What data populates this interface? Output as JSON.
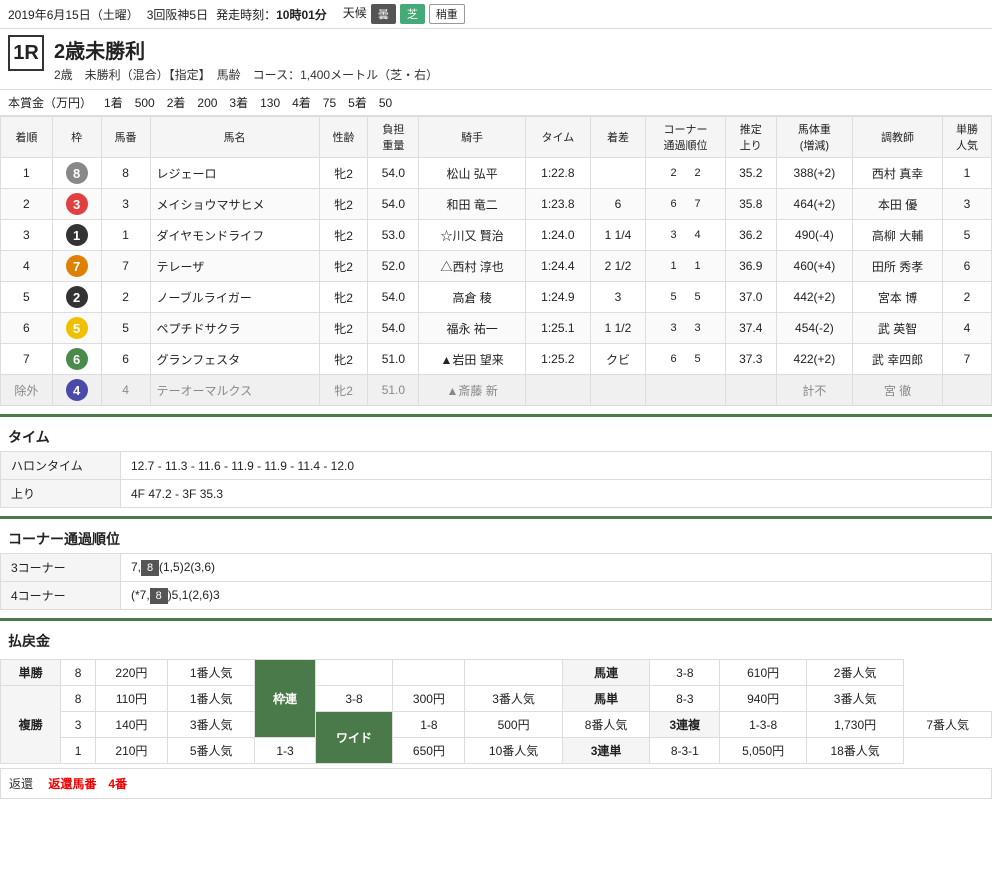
{
  "header": {
    "date": "2019年6月15日（土曜）",
    "session": "3回阪神5日",
    "start_time_label": "発走時刻：",
    "start_time": "10時01分",
    "weather_label": "天候",
    "weather": "曇",
    "track_label": "芝",
    "track_condition": "稍重"
  },
  "race": {
    "number": "1R",
    "title": "2歳未勝利",
    "subtitle1": "2歳　未勝利（混合）【指定】　馬齢　コース：1,400メートル（芝・右）"
  },
  "prize": {
    "label": "本賞金（万円）",
    "items": [
      {
        "place": "1着",
        "amount": "500"
      },
      {
        "place": "2着",
        "amount": "200"
      },
      {
        "place": "3着",
        "amount": "130"
      },
      {
        "place": "4着",
        "amount": "75"
      },
      {
        "place": "5着",
        "amount": "50"
      }
    ]
  },
  "table_headers": {
    "rank": "着順",
    "frame": "枠",
    "horse_num": "馬番",
    "horse_name": "馬名",
    "sex_age": "性齢",
    "weight": "負担\n重量",
    "jockey": "騎手",
    "time": "タイム",
    "margin": "着差",
    "corner": "コーナー\n通過順位",
    "last3f": "推定\n上り",
    "horse_weight": "馬体重\n(増減)",
    "trainer": "調教師",
    "odds": "単勝\n人気"
  },
  "results": [
    {
      "rank": "1",
      "frame": "8",
      "frame_color": "#888",
      "horse_num": "8",
      "horse_name": "レジェーロ",
      "sex_age": "牝2",
      "weight": "54.0",
      "jockey": "松山 弘平",
      "time": "1:22.8",
      "margin": "",
      "corner1": "2",
      "corner2": "2",
      "c1_hl": false,
      "c2_hl": false,
      "last3f": "35.2",
      "horse_weight": "388(+2)",
      "trainer": "西村 真幸",
      "odds": "1",
      "excluded": false
    },
    {
      "rank": "2",
      "frame": "3",
      "frame_color": "#e04040",
      "horse_num": "3",
      "horse_name": "メイショウマサヒメ",
      "sex_age": "牝2",
      "weight": "54.0",
      "jockey": "和田 竜二",
      "time": "1:23.8",
      "margin": "6",
      "corner1": "6",
      "corner2": "7",
      "c1_hl": false,
      "c2_hl": false,
      "last3f": "35.8",
      "horse_weight": "464(+2)",
      "trainer": "本田 優",
      "odds": "3",
      "excluded": false
    },
    {
      "rank": "3",
      "frame": "1",
      "frame_color": "#333",
      "horse_num": "1",
      "horse_name": "ダイヤモンドライフ",
      "sex_age": "牝2",
      "weight": "53.0",
      "jockey": "☆川又 賢治",
      "time": "1:24.0",
      "margin": "1 1/4",
      "corner1": "3",
      "corner2": "4",
      "c1_hl": false,
      "c2_hl": false,
      "last3f": "36.2",
      "horse_weight": "490(-4)",
      "trainer": "高柳 大輔",
      "odds": "5",
      "excluded": false
    },
    {
      "rank": "4",
      "frame": "7",
      "frame_color": "#e08000",
      "horse_num": "7",
      "horse_name": "テレーザ",
      "sex_age": "牝2",
      "weight": "52.0",
      "jockey": "△西村 淳也",
      "time": "1:24.4",
      "margin": "2 1/2",
      "corner1": "1",
      "corner2": "1",
      "c1_hl": false,
      "c2_hl": false,
      "last3f": "36.9",
      "horse_weight": "460(+4)",
      "trainer": "田所 秀孝",
      "odds": "6",
      "excluded": false
    },
    {
      "rank": "5",
      "frame": "2",
      "frame_color": "#333",
      "horse_num": "2",
      "horse_name": "ノーブルライガー",
      "sex_age": "牝2",
      "weight": "54.0",
      "jockey": "高倉 稜",
      "time": "1:24.9",
      "margin": "3",
      "corner1": "5",
      "corner2": "5",
      "c1_hl": false,
      "c2_hl": false,
      "last3f": "37.0",
      "horse_weight": "442(+2)",
      "trainer": "宮本 博",
      "odds": "2",
      "excluded": false
    },
    {
      "rank": "6",
      "frame": "5",
      "frame_color": "#f0c000",
      "horse_num": "5",
      "horse_name": "ペプチドサクラ",
      "sex_age": "牝2",
      "weight": "54.0",
      "jockey": "福永 祐一",
      "time": "1:25.1",
      "margin": "1 1/2",
      "corner1": "3",
      "corner2": "3",
      "c1_hl": false,
      "c2_hl": false,
      "last3f": "37.4",
      "horse_weight": "454(-2)",
      "trainer": "武 英智",
      "odds": "4",
      "excluded": false
    },
    {
      "rank": "7",
      "frame": "6",
      "frame_color": "#4a8a4a",
      "horse_num": "6",
      "horse_name": "グランフェスタ",
      "sex_age": "牝2",
      "weight": "51.0",
      "jockey": "▲岩田 望来",
      "time": "1:25.2",
      "margin": "クビ",
      "corner1": "6",
      "corner2": "5",
      "c1_hl": false,
      "c2_hl": false,
      "last3f": "37.3",
      "horse_weight": "422(+2)",
      "trainer": "武 幸四郎",
      "odds": "7",
      "excluded": false
    },
    {
      "rank": "除外",
      "frame": "4",
      "frame_color": "#4a4aaa",
      "horse_num": "4",
      "horse_name": "テーオーマルクス",
      "sex_age": "牝2",
      "weight": "51.0",
      "jockey": "▲斎藤 新",
      "time": "",
      "margin": "",
      "corner1": "",
      "corner2": "",
      "c1_hl": false,
      "c2_hl": false,
      "last3f": "",
      "horse_weight": "計不",
      "trainer": "宮 徹",
      "odds": "",
      "excluded": true
    }
  ],
  "time_section": {
    "title": "タイム",
    "halon_label": "ハロンタイム",
    "halon_value": "12.7 - 11.3 - 11.6 - 11.9 - 11.9 - 11.4 - 12.0",
    "agari_label": "上り",
    "agari_value": "4F 47.2 - 3F 35.3"
  },
  "corner_section": {
    "title": "コーナー通過順位",
    "corner3_label": "3コーナー",
    "corner3_value": "7,",
    "corner3_highlight": "8",
    "corner3_rest": "(1,5)2(3,6)",
    "corner4_label": "4コーナー",
    "corner4_prefix": "(*7,",
    "corner4_highlight": "8",
    "corner4_suffix": ")5,1(2,6)3"
  },
  "payout_section": {
    "title": "払戻金",
    "rows": {
      "tansho": {
        "label": "単勝",
        "num": "8",
        "amount": "220円",
        "popularity": "1番人気"
      },
      "wakuren": {
        "label": "枠連",
        "entries": []
      },
      "umaren": {
        "label": "馬連",
        "num": "3-8",
        "amount": "610円",
        "popularity": "2番人気"
      },
      "fukusho": {
        "label": "複勝",
        "entries": [
          {
            "num": "8",
            "amount": "110円",
            "popularity": "1番人気"
          },
          {
            "num": "3",
            "amount": "140円",
            "popularity": "3番人気"
          },
          {
            "num": "1",
            "amount": "210円",
            "popularity": "5番人気"
          }
        ]
      },
      "wide": {
        "label": "ワイド",
        "entries": [
          {
            "num": "3-8",
            "amount": "300円",
            "popularity": "3番人気"
          },
          {
            "num": "1-8",
            "amount": "500円",
            "popularity": "8番人気"
          },
          {
            "num": "1-3",
            "amount": "650円",
            "popularity": "10番人気"
          }
        ]
      },
      "umatan": {
        "label": "馬単",
        "num": "8-3",
        "amount": "940円",
        "popularity": "3番人気"
      },
      "sanrenpuku": {
        "label": "3連複",
        "num": "1-3-8",
        "amount": "1,730円",
        "popularity": "7番人気"
      },
      "sanrentan": {
        "label": "3連単",
        "num": "8-3-1",
        "amount": "5,050円",
        "popularity": "18番人気"
      }
    }
  },
  "return_section": {
    "label": "返還",
    "horse_label": "返還馬番",
    "horse_num": "4番"
  }
}
